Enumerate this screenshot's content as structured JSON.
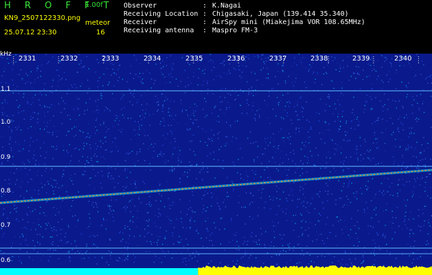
{
  "header": {
    "app_title": "H R O F F T",
    "version": "1.00f",
    "file_name": "KN9_2507122330.png",
    "meteor_label": "meteor",
    "date_time": "25.07.12 23:30",
    "meteor_count": "16"
  },
  "info": [
    {
      "label": "Observer",
      "value": "K.Nagai"
    },
    {
      "label": "Receiving Location",
      "value": "Chigasaki, Japan (139.414 35.340)"
    },
    {
      "label": "Receiver",
      "value": "AirSpy mini (Miakejima VOR 108.65MHz)"
    },
    {
      "label": "Receiving antenna",
      "value": "Maspro FM-3"
    }
  ],
  "info_separator": ":",
  "colors": {
    "background": "#000000",
    "spectrum_bg": "#0a1a8c",
    "title_green": "#39e639",
    "label_yellow": "#ffff00",
    "level_cyan": "#00ffff"
  },
  "chart_data": {
    "type": "heatmap",
    "ylabel": "kHz",
    "y_ticks": [
      "1.1",
      "1.0",
      "0.9",
      "0.8",
      "0.7",
      "0.6"
    ],
    "y_tick_values": [
      1.1,
      1.0,
      0.9,
      0.8,
      0.7,
      0.6
    ],
    "x_ticks": [
      "2331",
      "2332",
      "2333",
      "2334",
      "2335",
      "2336",
      "2337",
      "2338",
      "2339",
      "2340"
    ],
    "x_tick_values": [
      2331,
      2332,
      2333,
      2334,
      2335,
      2336,
      2337,
      2338,
      2339,
      2340
    ],
    "xlim": [
      2330.7,
      2340.3
    ],
    "ylim": [
      0.57,
      1.207
    ],
    "horizontal_lines_khz": [
      1.095,
      0.868,
      0.622,
      0.605
    ],
    "trail": {
      "x": [
        2330.7,
        2340.3
      ],
      "y": [
        0.758,
        0.857
      ]
    },
    "level_bar": [
      {
        "x_start": 2330.7,
        "x_end": 2335.1,
        "color": "#00ffff"
      },
      {
        "x_start": 2335.1,
        "x_end": 2340.3,
        "color": "#ffff00"
      }
    ]
  }
}
